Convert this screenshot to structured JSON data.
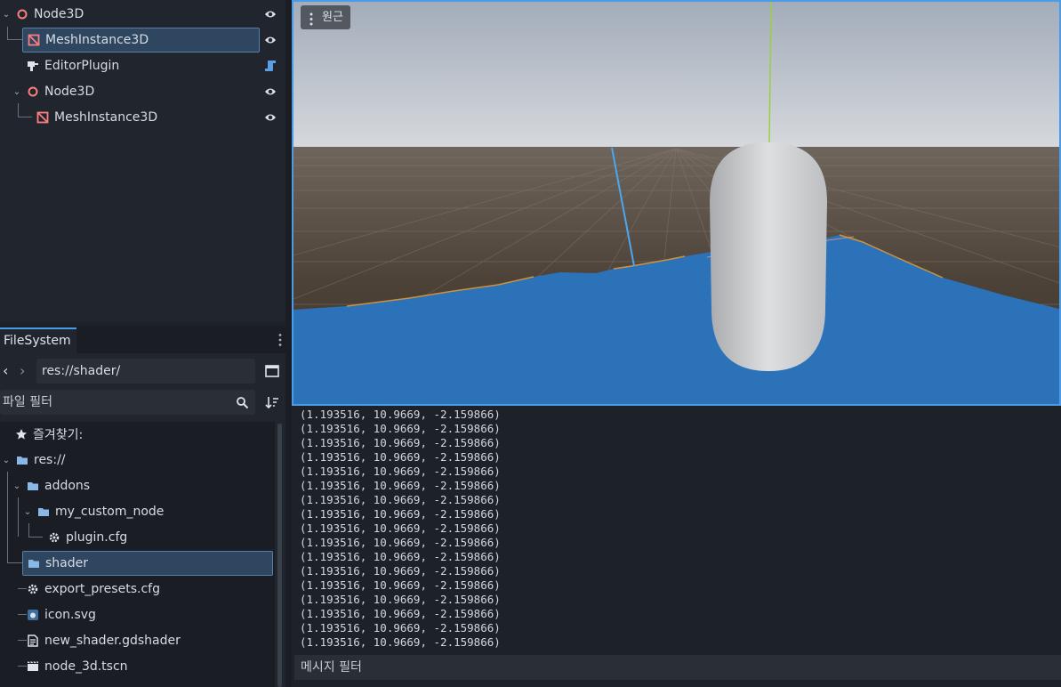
{
  "scene_tree": {
    "items": [
      {
        "label": "Node3D",
        "icon": "node3d-icon"
      },
      {
        "label": "MeshInstance3D",
        "icon": "meshinstance-icon"
      },
      {
        "label": "EditorPlugin",
        "icon": "editorplugin-icon"
      },
      {
        "label": "Node3D",
        "icon": "node3d-icon"
      },
      {
        "label": "MeshInstance3D",
        "icon": "meshinstance-icon"
      }
    ]
  },
  "filesystem": {
    "tab_label": "FileSystem",
    "path": "res://shader/",
    "filter_placeholder": "파일 필터",
    "items": [
      {
        "label": "즐겨찾기:",
        "icon": "star-icon"
      },
      {
        "label": "res://",
        "icon": "folder-icon"
      },
      {
        "label": "addons",
        "icon": "folder-icon"
      },
      {
        "label": "my_custom_node",
        "icon": "folder-icon"
      },
      {
        "label": "plugin.cfg",
        "icon": "gear-file-icon"
      },
      {
        "label": "shader",
        "icon": "folder-icon"
      },
      {
        "label": "export_presets.cfg",
        "icon": "gear-file-icon"
      },
      {
        "label": "icon.svg",
        "icon": "image-file-icon"
      },
      {
        "label": "new_shader.gdshader",
        "icon": "text-file-icon"
      },
      {
        "label": "node_3d.tscn",
        "icon": "scene-file-icon"
      }
    ]
  },
  "viewport": {
    "view_button": "원근"
  },
  "output": {
    "lines": [
      "(1.193516, 10.9669, -2.159866)",
      "(1.193516, 10.9669, -2.159866)",
      "(1.193516, 10.9669, -2.159866)",
      "(1.193516, 10.9669, -2.159866)",
      "(1.193516, 10.9669, -2.159866)",
      "(1.193516, 10.9669, -2.159866)",
      "(1.193516, 10.9669, -2.159866)",
      "(1.193516, 10.9669, -2.159866)",
      "(1.193516, 10.9669, -2.159866)",
      "(1.193516, 10.9669, -2.159866)",
      "(1.193516, 10.9669, -2.159866)",
      "(1.193516, 10.9669, -2.159866)",
      "(1.193516, 10.9669, -2.159866)",
      "(1.193516, 10.9669, -2.159866)",
      "(1.193516, 10.9669, -2.159866)",
      "(1.193516, 10.9669, -2.159866)",
      "(1.193516, 10.9669, -2.159866)"
    ],
    "filter_placeholder": "메시지 필터"
  },
  "colors": {
    "accent": "#4a9be8",
    "selection": "#2f4660",
    "node3d": "#fc7f7f",
    "folder": "#8ab8e6",
    "water": "#2c72b8",
    "ground": "#4a3f36"
  }
}
